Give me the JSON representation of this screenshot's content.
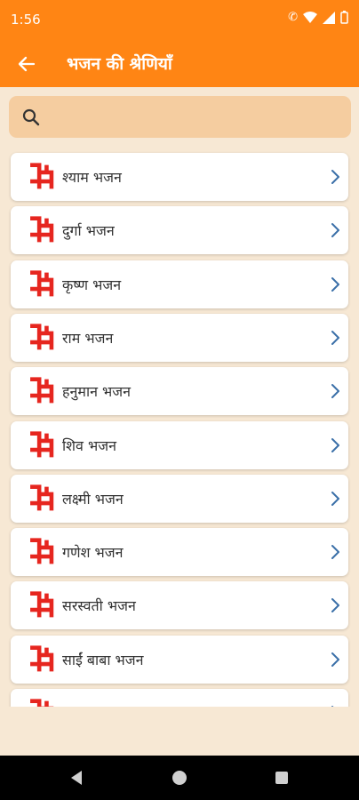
{
  "status_bar": {
    "time": "1:56"
  },
  "header": {
    "title": "भजन की श्रेणियाँ"
  },
  "search": {
    "placeholder": "",
    "value": ""
  },
  "items": [
    {
      "label": "श्याम भजन"
    },
    {
      "label": "दुर्गा भजन"
    },
    {
      "label": "कृष्ण भजन"
    },
    {
      "label": "राम भजन"
    },
    {
      "label": "हनुमान भजन"
    },
    {
      "label": "शिव भजन"
    },
    {
      "label": "लक्ष्मी भजन"
    },
    {
      "label": "गणेश भजन"
    },
    {
      "label": "सरस्वती भजन"
    },
    {
      "label": "साईं बाबा भजन"
    },
    {
      "label": ""
    }
  ],
  "colors": {
    "accent": "#ff8514",
    "background": "#f7e8d4",
    "search_bg": "#f5cda0",
    "icon_red": "#e6261f",
    "chevron": "#3a6fa8"
  }
}
